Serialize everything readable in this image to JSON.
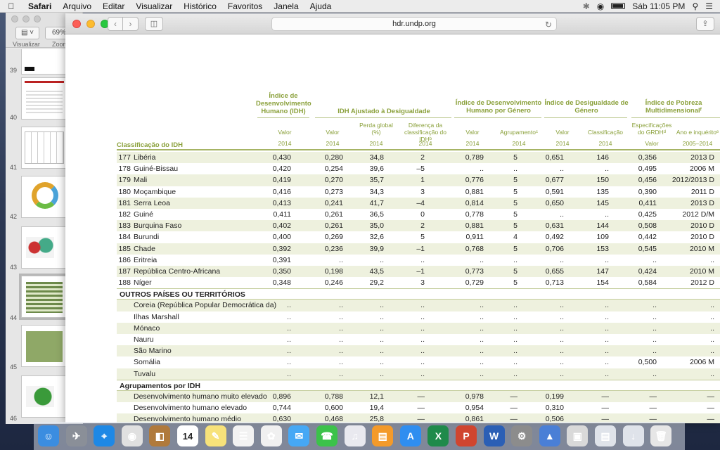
{
  "menubar": {
    "apple_icon": "apple-icon",
    "app": "Safari",
    "items": [
      "Arquivo",
      "Editar",
      "Visualizar",
      "Histórico",
      "Favoritos",
      "Janela",
      "Ajuda"
    ],
    "clock": "Sáb 11:05 PM"
  },
  "preview": {
    "zoom": "69%",
    "view_label": "Visualizar",
    "zoom_label": "Zoom",
    "page_numbers": [
      "39",
      "40",
      "41",
      "42",
      "43",
      "44",
      "45",
      "46"
    ]
  },
  "safari": {
    "url": "hdr.undp.org",
    "back_icon": "chevron-left-icon",
    "forward_icon": "chevron-right-icon"
  },
  "table": {
    "rank_header": "Classificação do IDH",
    "groups": [
      "Índice de Desenvolvimento Humano (IDH)",
      "IDH Ajustado à Desigualdade",
      "Índice de Desenvolvimento Humano por Género",
      "Índice de Desigualdade de Género",
      "Índice de Pobreza Multidimensionalᶠ"
    ],
    "subheaders": [
      "Valor",
      "Valor",
      "Perda global (%)",
      "Diferença da classificação do IDHᵇ",
      "Valor",
      "Agrupamentoᶜ",
      "Valor",
      "Classificação",
      "Especificações do GRDHᵈ",
      "Ano e inquéritoᵉ"
    ],
    "subheaders_extra": [
      "Valor"
    ],
    "years": [
      "2014",
      "2014",
      "2014",
      "2014",
      "2014",
      "2014",
      "2014",
      "2014",
      "Valor",
      "2005–2014"
    ],
    "rows": [
      {
        "rank": "177",
        "name": "Libéria",
        "v": [
          "0,430",
          "0,280",
          "34,8",
          "2",
          "0,789",
          "5",
          "0,651",
          "146",
          "0,356",
          "2013 D"
        ]
      },
      {
        "rank": "178",
        "name": "Guiné-Bissau",
        "v": [
          "0,420",
          "0,254",
          "39,6",
          "–5",
          "..",
          "..",
          "..",
          "..",
          "0,495",
          "2006 M"
        ]
      },
      {
        "rank": "179",
        "name": "Mali",
        "v": [
          "0,419",
          "0,270",
          "35,7",
          "1",
          "0,776",
          "5",
          "0,677",
          "150",
          "0,456",
          "2012/2013 D"
        ]
      },
      {
        "rank": "180",
        "name": "Moçambique",
        "v": [
          "0,416",
          "0,273",
          "34,3",
          "3",
          "0,881",
          "5",
          "0,591",
          "135",
          "0,390",
          "2011 D"
        ]
      },
      {
        "rank": "181",
        "name": "Serra Leoa",
        "v": [
          "0,413",
          "0,241",
          "41,7",
          "–4",
          "0,814",
          "5",
          "0,650",
          "145",
          "0,411",
          "2013 D"
        ]
      },
      {
        "rank": "182",
        "name": "Guiné",
        "v": [
          "0,411",
          "0,261",
          "36,5",
          "0",
          "0,778",
          "5",
          "..",
          "..",
          "0,425",
          "2012 D/M"
        ]
      },
      {
        "rank": "183",
        "name": "Burquina Faso",
        "v": [
          "0,402",
          "0,261",
          "35,0",
          "2",
          "0,881",
          "5",
          "0,631",
          "144",
          "0,508",
          "2010 D"
        ]
      },
      {
        "rank": "184",
        "name": "Burundi",
        "v": [
          "0,400",
          "0,269",
          "32,6",
          "5",
          "0,911",
          "4",
          "0,492",
          "109",
          "0,442",
          "2010 D"
        ]
      },
      {
        "rank": "185",
        "name": "Chade",
        "v": [
          "0,392",
          "0,236",
          "39,9",
          "–1",
          "0,768",
          "5",
          "0,706",
          "153",
          "0,545",
          "2010 M"
        ]
      },
      {
        "rank": "186",
        "name": "Eritreia",
        "v": [
          "0,391",
          "..",
          "..",
          "..",
          "..",
          "..",
          "..",
          "..",
          "..",
          ".."
        ]
      },
      {
        "rank": "187",
        "name": "República Centro-Africana",
        "v": [
          "0,350",
          "0,198",
          "43,5",
          "–1",
          "0,773",
          "5",
          "0,655",
          "147",
          "0,424",
          "2010 M"
        ]
      },
      {
        "rank": "188",
        "name": "Níger",
        "v": [
          "0,348",
          "0,246",
          "29,2",
          "3",
          "0,729",
          "5",
          "0,713",
          "154",
          "0,584",
          "2012 D"
        ]
      }
    ],
    "section_other": "OUTROS PAÍSES OU TERRITÓRIOS",
    "other_rows": [
      {
        "name": "Coreia (República Popular Democrática da)",
        "v": [
          "..",
          "..",
          "..",
          "..",
          "..",
          "..",
          "..",
          "..",
          "..",
          ".."
        ]
      },
      {
        "name": "Ilhas Marshall",
        "v": [
          "..",
          "..",
          "..",
          "..",
          "..",
          "..",
          "..",
          "..",
          "..",
          ".."
        ]
      },
      {
        "name": "Mónaco",
        "v": [
          "..",
          "..",
          "..",
          "..",
          "..",
          "..",
          "..",
          "..",
          "..",
          ".."
        ]
      },
      {
        "name": "Nauru",
        "v": [
          "..",
          "..",
          "..",
          "..",
          "..",
          "..",
          "..",
          "..",
          "..",
          ".."
        ]
      },
      {
        "name": "São Marino",
        "v": [
          "..",
          "..",
          "..",
          "..",
          "..",
          "..",
          "..",
          "..",
          "..",
          ".."
        ]
      },
      {
        "name": "Somália",
        "v": [
          "..",
          "..",
          "..",
          "..",
          "..",
          "..",
          "..",
          "..",
          "0,500",
          "2006 M"
        ]
      },
      {
        "name": "Tuvalu",
        "v": [
          "..",
          "..",
          "..",
          "..",
          "..",
          "..",
          "..",
          "..",
          "..",
          ".."
        ]
      }
    ],
    "section_groups": "Agrupamentos por IDH",
    "group_rows": [
      {
        "name": "Desenvolvimento humano muito elevado",
        "v": [
          "0,896",
          "0,788",
          "12,1",
          "—",
          "0,978",
          "—",
          "0,199",
          "—",
          "—",
          "—"
        ]
      },
      {
        "name": "Desenvolvimento humano elevado",
        "v": [
          "0,744",
          "0,600",
          "19,4",
          "—",
          "0,954",
          "—",
          "0,310",
          "—",
          "—",
          "—"
        ]
      },
      {
        "name": "Desenvolvimento humano médio",
        "v": [
          "0,630",
          "0,468",
          "25,8",
          "—",
          "0,861",
          "—",
          "0,506",
          "—",
          "—",
          "—"
        ]
      }
    ]
  },
  "dock": {
    "icons": [
      "finder-icon",
      "launchpad-icon",
      "safari-icon",
      "chrome-icon",
      "contacts-icon",
      "calendar-icon",
      "notes-icon",
      "reminders-icon",
      "photos-icon",
      "messages-icon",
      "facetime-icon",
      "itunes-icon",
      "ibooks-icon",
      "appstore-icon",
      "excel-icon",
      "powerpoint-icon",
      "word-icon",
      "system-preferences-icon",
      "keynote-icon",
      "preview-icon",
      "documents-icon",
      "downloads-icon",
      "trash-icon"
    ],
    "calendar_day": "14"
  }
}
